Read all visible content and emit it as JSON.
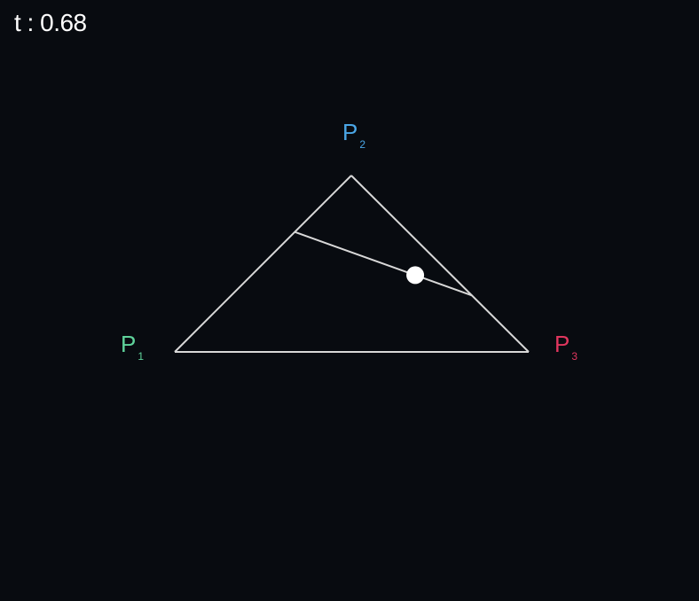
{
  "readout": {
    "label": "t",
    "separator": " : ",
    "value": "0.68"
  },
  "points": [
    {
      "id": "p1",
      "letter": "P",
      "sub": "1",
      "color": "#5fd39b"
    },
    {
      "id": "p2",
      "letter": "P",
      "sub": "2",
      "color": "#4aa6e6"
    },
    {
      "id": "p3",
      "letter": "P",
      "sub": "3",
      "color": "#e0365e"
    }
  ],
  "t": 0.68,
  "colors": {
    "background": "#080b10",
    "lines": "#d8d8d8",
    "marker": "#ffffff"
  }
}
